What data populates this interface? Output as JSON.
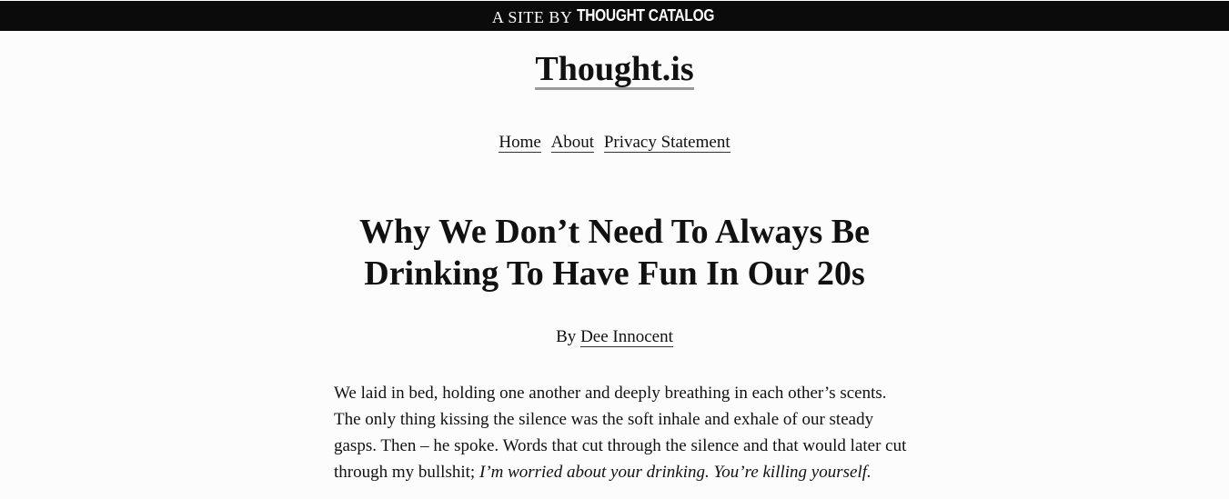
{
  "topbar": {
    "prefix": "A SITE BY",
    "brand": "THOUGHT CATALOG"
  },
  "site": {
    "title": "Thought.is"
  },
  "nav": {
    "items": [
      {
        "label": "Home"
      },
      {
        "label": "About"
      },
      {
        "label": "Privacy Statement"
      }
    ]
  },
  "article": {
    "title": "Why We Don’t Need To Always Be Drinking To Have Fun In Our 20s",
    "byline_prefix": "By",
    "author": "Dee Innocent",
    "paragraph_text": "We laid in bed, holding one another and deeply breathing in each other’s scents. The only thing kissing the silence was the soft inhale and exhale of our steady gasps. Then – he spoke. Words that cut through the silence and that would later cut through my bullshit; ",
    "paragraph_italic": "I’m worried about your drinking. You’re killing yourself."
  }
}
